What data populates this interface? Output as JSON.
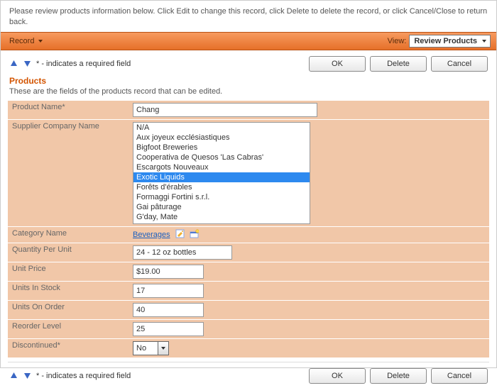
{
  "instructions": "Please review products information below. Click Edit to change this record, click Delete to delete the record, or click Cancel/Close to return back.",
  "toolbar": {
    "record_label": "Record",
    "view_label": "View:",
    "view_selected": "Review Products"
  },
  "required_note": "* - indicates a required field",
  "buttons": {
    "ok": "OK",
    "delete": "Delete",
    "cancel": "Cancel"
  },
  "section": {
    "title": "Products",
    "subtitle": "These are the fields of the products record that can be edited."
  },
  "fields": {
    "product_name": {
      "label": "Product Name",
      "required": "*",
      "value": "Chang"
    },
    "supplier": {
      "label": "Supplier Company Name",
      "options": [
        "N/A",
        "Aux joyeux ecclésiastiques",
        "Bigfoot Breweries",
        "Cooperativa de Quesos 'Las Cabras'",
        "Escargots Nouveaux",
        "Exotic Liquids",
        "Forêts d'érables",
        "Formaggi Fortini s.r.l.",
        "Gai pâturage",
        "G'day, Mate"
      ],
      "selected_index": 5
    },
    "category": {
      "label": "Category Name",
      "value": "Beverages"
    },
    "qpu": {
      "label": "Quantity Per Unit",
      "value": "24 - 12 oz bottles"
    },
    "unit_price": {
      "label": "Unit Price",
      "value": "$19.00"
    },
    "units_in_stock": {
      "label": "Units In Stock",
      "value": "17"
    },
    "units_on_order": {
      "label": "Units On Order",
      "value": "40"
    },
    "reorder_level": {
      "label": "Reorder Level",
      "value": "25"
    },
    "discontinued": {
      "label": "Discontinued",
      "required": "*",
      "value": "No"
    }
  }
}
